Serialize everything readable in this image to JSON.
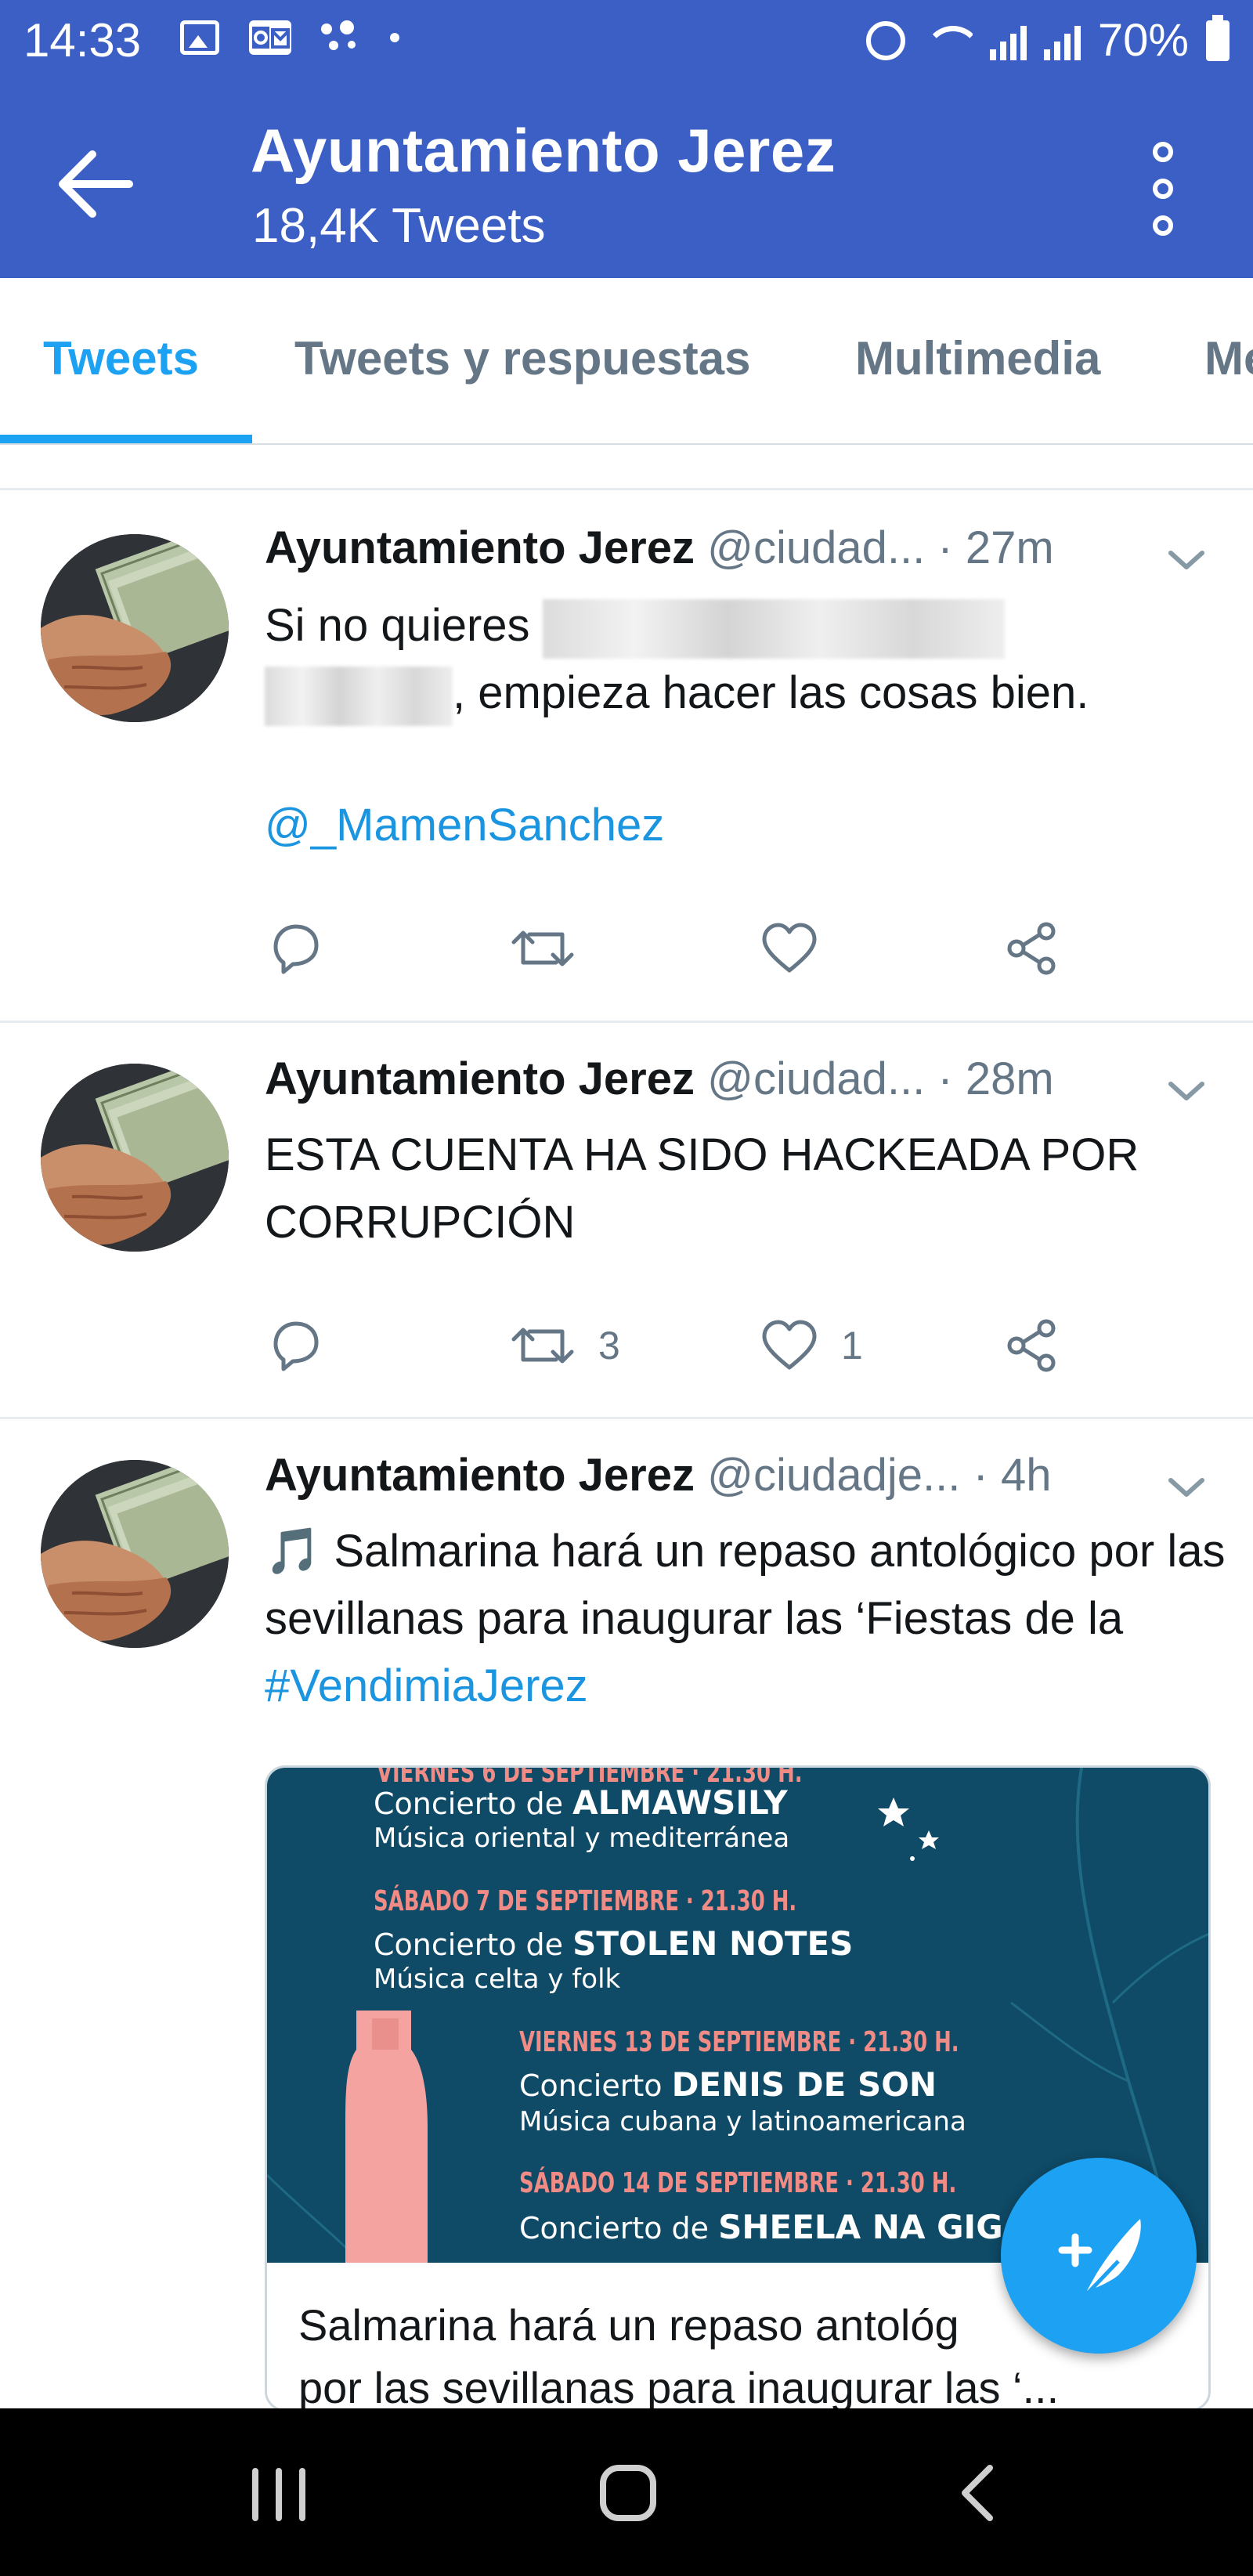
{
  "status_bar": {
    "time": "14:33",
    "battery": "70%",
    "icons": [
      "image-icon",
      "outlook-icon",
      "assistant-dots-icon",
      "dot-icon",
      "alarm-icon",
      "wifi-icon",
      "signal-icon",
      "signal-icon",
      "battery-icon"
    ]
  },
  "header": {
    "title": "Ayuntamiento Jerez",
    "subtitle": "18,4K Tweets"
  },
  "tabs": [
    {
      "label": "Tweets",
      "active": true
    },
    {
      "label": "Tweets y respuestas",
      "active": false
    },
    {
      "label": "Multimedia",
      "active": false
    },
    {
      "label": "Me",
      "active": false
    }
  ],
  "tweets": [
    {
      "name": "Ayuntamiento Jerez",
      "handle": "@ciudad...",
      "time": "· 27m",
      "text_prefix": "Si no quieres",
      "text_suffix": ", empieza hacer las cosas bien.",
      "mention": "@_MamenSanchez",
      "retweets": "",
      "likes": ""
    },
    {
      "name": "Ayuntamiento Jerez",
      "handle": "@ciudad...",
      "time": "· 28m",
      "text": "ESTA CUENTA HA SIDO HACKEADA POR CORRUPCIÓN",
      "retweets": "3",
      "likes": "1"
    },
    {
      "name": "Ayuntamiento Jerez",
      "handle": "@ciudadje...",
      "time": "· 4h",
      "text_icon": "🎵",
      "text": "Salmarina hará un repaso antológico por las sevillanas para inaugurar las ‘Fiestas de la",
      "hashtag": "#VendimiaJerez",
      "card": {
        "poster": {
          "line0": "VIERNES 6 DE SEPTIEMBRE · 21.30 H.",
          "c1_prefix": "Concierto de",
          "c1_name": "ALMAWSILY",
          "c1_genre": "Música oriental y mediterránea",
          "d2": "SÁBADO 7 DE SEPTIEMBRE · 21.30 H.",
          "c2_prefix": "Concierto de",
          "c2_name": "STOLEN NOTES",
          "c2_genre": "Música celta y folk",
          "d3": "VIERNES 13 DE SEPTIEMBRE · 21.30 H.",
          "c3_prefix": "Concierto",
          "c3_name": "DENIS DE SON",
          "c3_genre": "Música cubana y latinoamericana",
          "d4": "SÁBADO 14 DE SEPTIEMBRE · 21.30 H.",
          "c4_prefix": "Concierto de",
          "c4_name": "SHEELA NA GIG"
        },
        "title_line1": "Salmarina hará un repaso antológ",
        "title_line2": "por las sevillanas para inaugurar las ‘..."
      }
    }
  ],
  "colors": {
    "header_blue": "#3b5fc4",
    "twitter_blue": "#1da1f2",
    "link_blue": "#1b95e0",
    "secondary_text": "#657786",
    "poster_bg": "#0f4a66"
  }
}
